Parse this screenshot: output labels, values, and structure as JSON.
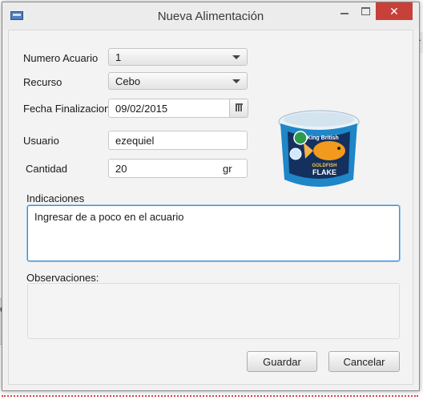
{
  "window": {
    "title": "Nueva Alimentación",
    "close_glyph": "✕"
  },
  "form": {
    "acuario": {
      "label": "Numero Acuario",
      "value": "1"
    },
    "recurso": {
      "label": "Recurso",
      "value": "Cebo"
    },
    "fecha": {
      "label": "Fecha Finalizacion",
      "value": "09/02/2015"
    },
    "usuario": {
      "label": "Usuario",
      "value": "ezequiel"
    },
    "cantidad": {
      "label": "Cantidad",
      "value": "20",
      "unit": "gr"
    },
    "indicaciones": {
      "label": "Indicaciones",
      "value": "Ingresar de a poco en el acuario"
    },
    "observaciones": {
      "label": "Observaciones:",
      "value": ""
    }
  },
  "product": {
    "brand": "King British",
    "line1": "GOLDFISH",
    "line2": "FLAKE",
    "colors": {
      "tub": "#1f86c8",
      "lid": "#e9f2f8",
      "label": "#14305e",
      "fish": "#f19a1e"
    }
  },
  "buttons": {
    "guardar": "Guardar",
    "cancelar": "Cancelar"
  },
  "background": {
    "left_fragment": "e",
    "right_fragment": "E."
  }
}
